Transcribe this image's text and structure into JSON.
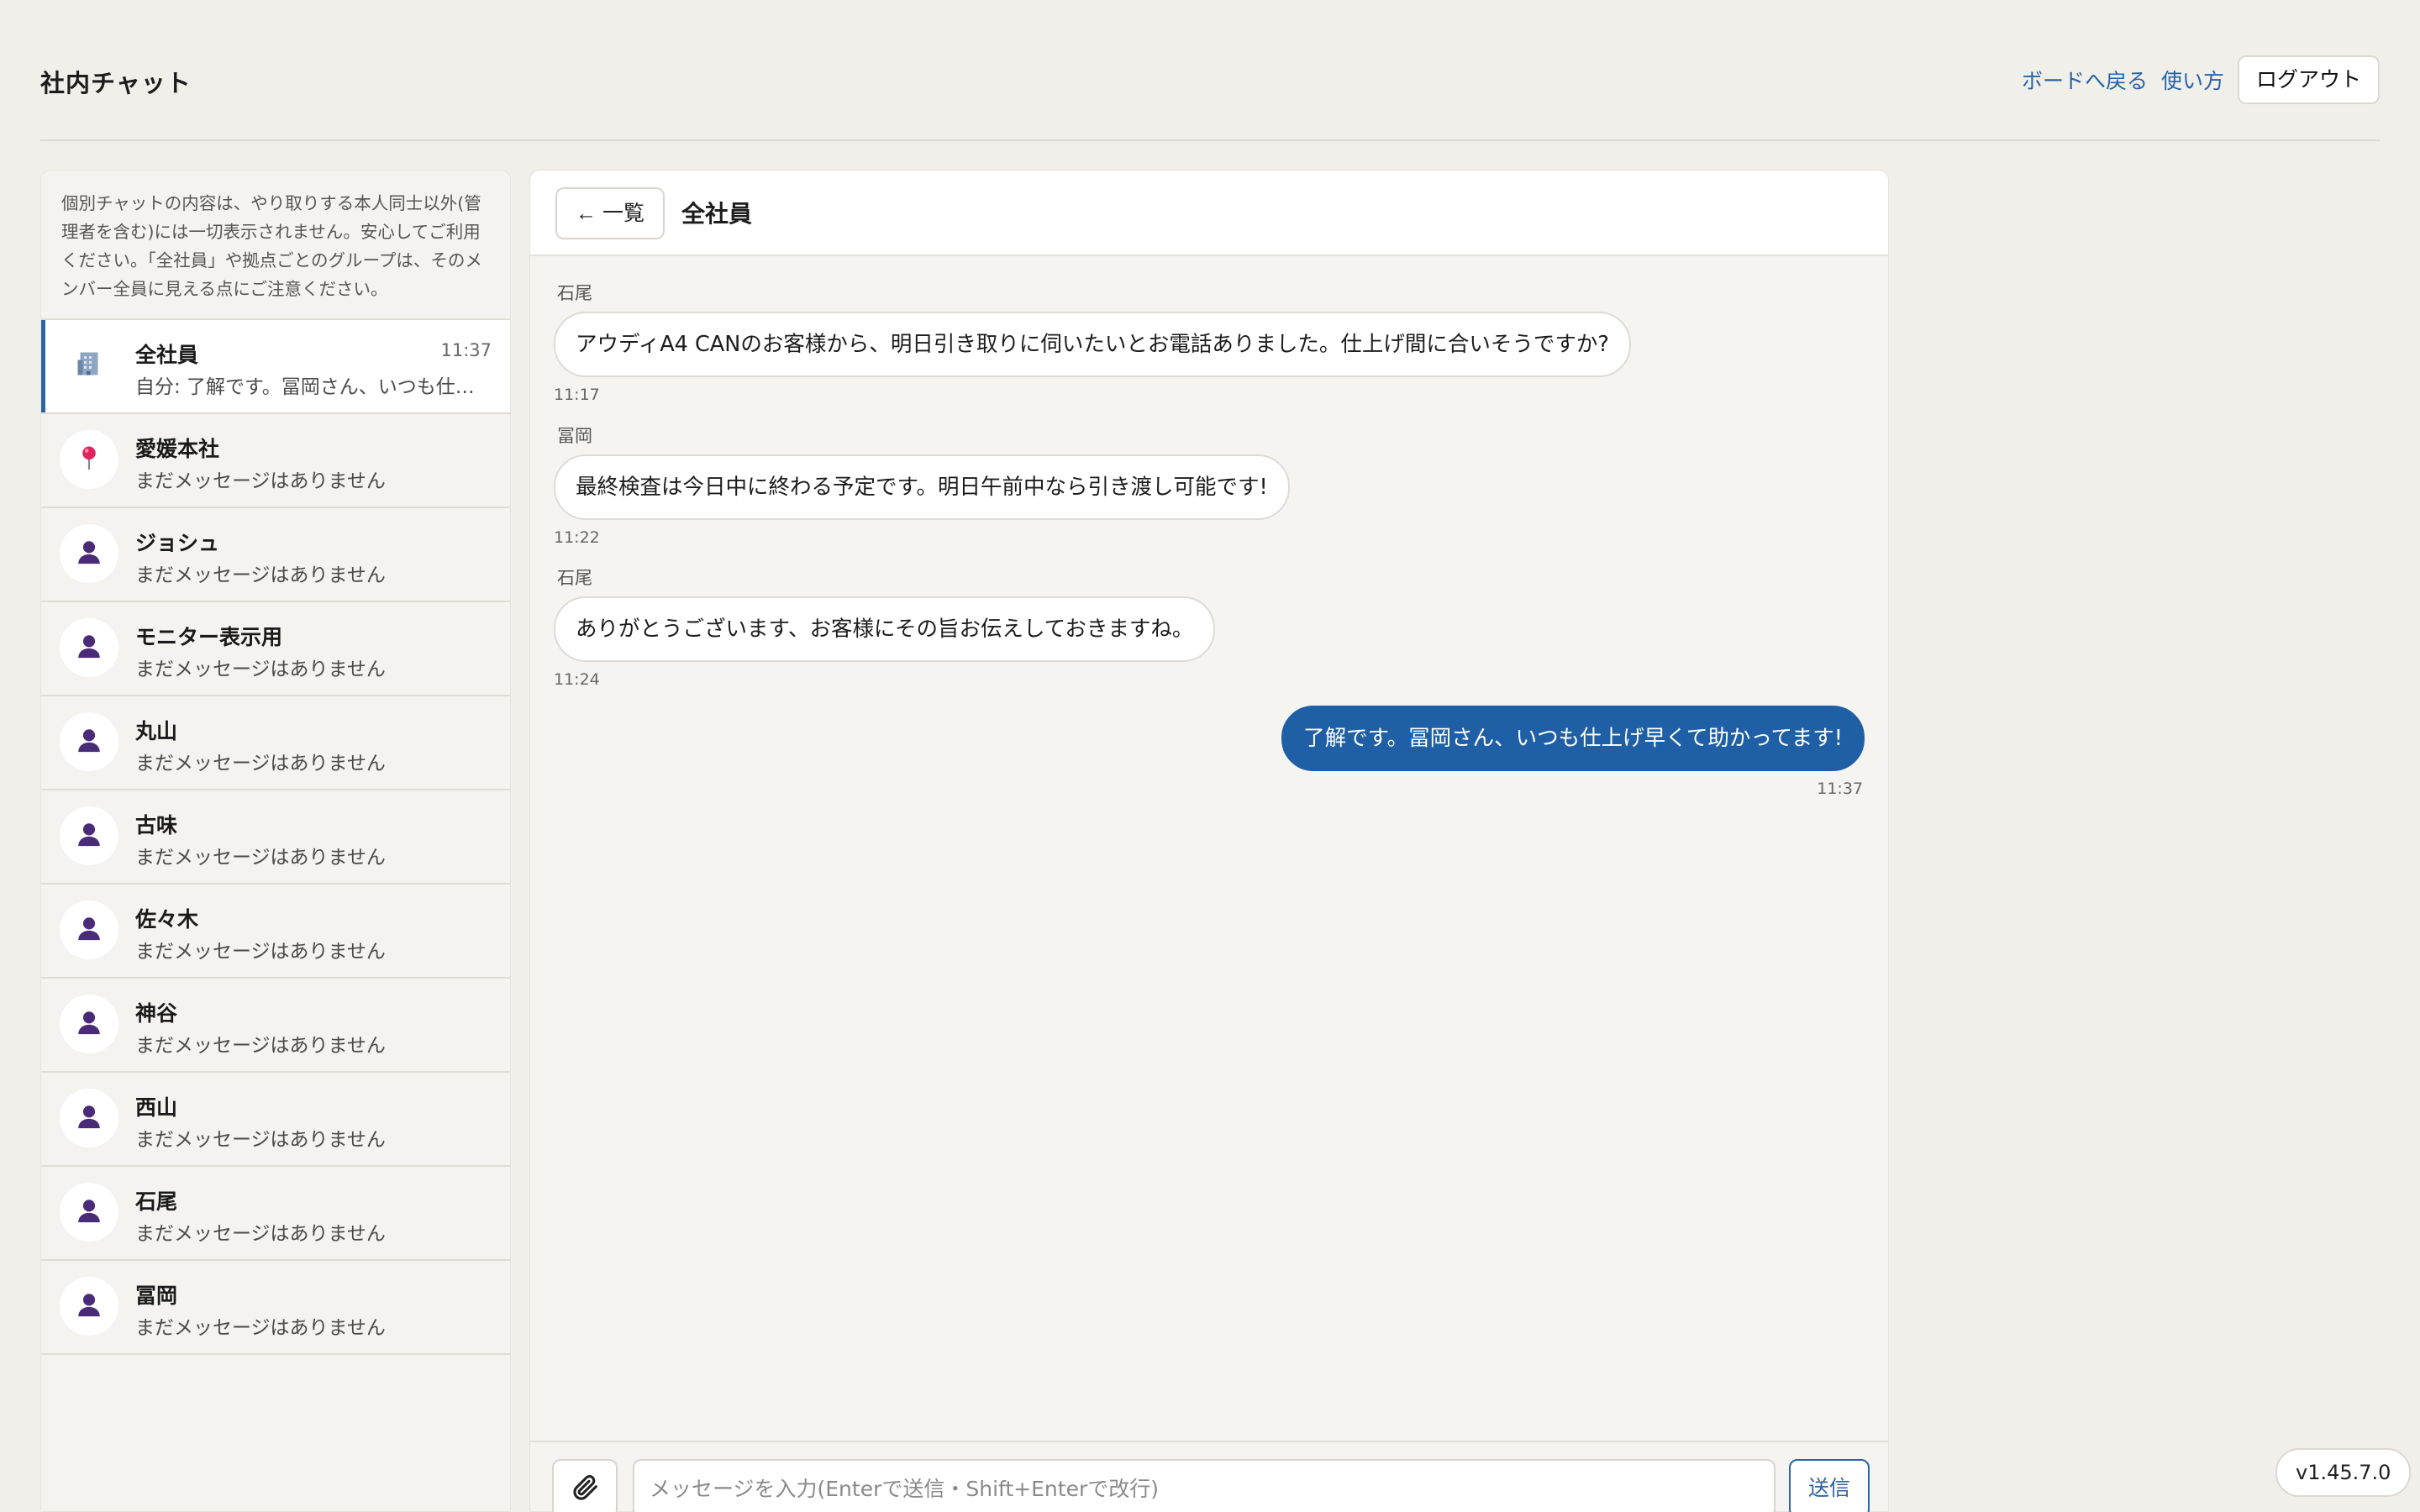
{
  "header": {
    "title": "社内チャット",
    "nav": {
      "board_link": "ボードへ戻る",
      "help_link": "使い方",
      "logout": "ログアウト"
    }
  },
  "sidebar": {
    "notice": "個別チャットの内容は、やり取りする本人同士以外(管理者を含む)には一切表示されません。安心してご利用ください。「全社員」や拠点ごとのグループは、そのメンバー全員に見える点にご注意ください。",
    "chats": [
      {
        "name": "全社員",
        "preview": "自分: 了解です。冨岡さん、いつも仕上げ早くて助かってます!",
        "time": "11:37",
        "icon": "building-icon",
        "active": true
      },
      {
        "name": "愛媛本社",
        "preview": "まだメッセージはありません",
        "time": "",
        "icon": "pin-icon"
      },
      {
        "name": "ジョシュ",
        "preview": "まだメッセージはありません",
        "time": "",
        "icon": "person-icon"
      },
      {
        "name": "モニター表示用",
        "preview": "まだメッセージはありません",
        "time": "",
        "icon": "person-icon"
      },
      {
        "name": "丸山",
        "preview": "まだメッセージはありません",
        "time": "",
        "icon": "person-icon"
      },
      {
        "name": "古味",
        "preview": "まだメッセージはありません",
        "time": "",
        "icon": "person-icon"
      },
      {
        "name": "佐々木",
        "preview": "まだメッセージはありません",
        "time": "",
        "icon": "person-icon"
      },
      {
        "name": "神谷",
        "preview": "まだメッセージはありません",
        "time": "",
        "icon": "person-icon"
      },
      {
        "name": "西山",
        "preview": "まだメッセージはありません",
        "time": "",
        "icon": "person-icon"
      },
      {
        "name": "石尾",
        "preview": "まだメッセージはありません",
        "time": "",
        "icon": "person-icon"
      },
      {
        "name": "冨岡",
        "preview": "まだメッセージはありません",
        "time": "",
        "icon": "person-icon"
      }
    ]
  },
  "main": {
    "back_label": "← 一覧",
    "room_title": "全社員",
    "messages": [
      {
        "sender": "石尾",
        "text": "アウディA4 CANのお客様から、明日引き取りに伺いたいとお電話ありました。仕上げ間に合いそうですか?",
        "time": "11:17",
        "own": false
      },
      {
        "sender": "冨岡",
        "text": "最終検査は今日中に終わる予定です。明日午前中なら引き渡し可能です!",
        "time": "11:22",
        "own": false
      },
      {
        "sender": "石尾",
        "text": "ありがとうございます、お客様にその旨お伝えしておきますね。",
        "time": "11:24",
        "own": false
      },
      {
        "sender": "",
        "text": "了解です。冨岡さん、いつも仕上げ早くて助かってます!",
        "time": "11:37",
        "own": true
      }
    ],
    "composer": {
      "placeholder": "メッセージを入力(Enterで送信・Shift+Enterで改行)",
      "send_label": "送信",
      "attach_icon": "paperclip-icon"
    }
  },
  "version": "v1.45.7.0",
  "colors": {
    "accent": "#1f5fa5",
    "link": "#2563a6",
    "avatar_purple": "#4a2b78",
    "pin_red": "#e0245e"
  }
}
